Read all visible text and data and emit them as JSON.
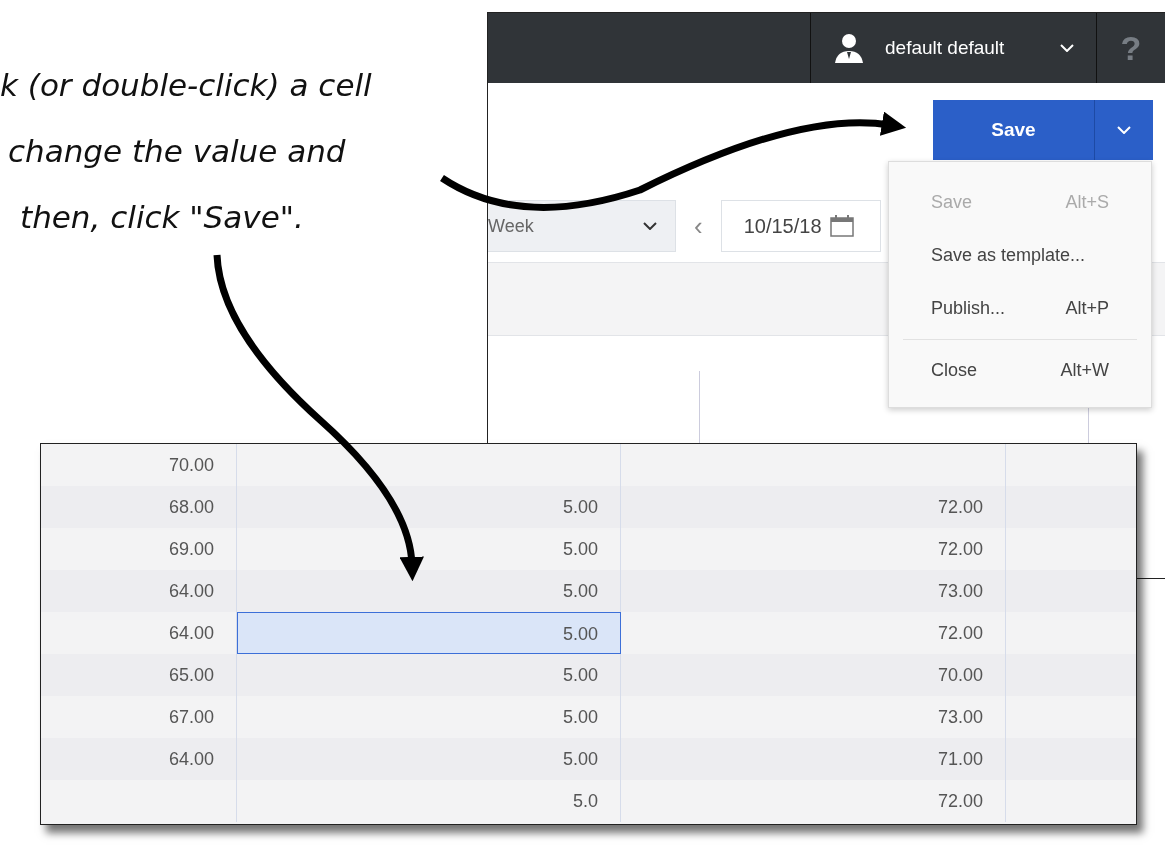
{
  "callout": {
    "lines": [
      "k (or double-click) a cell",
      "change the value and",
      "then, click \"Save\"."
    ]
  },
  "app": {
    "user": {
      "name": "default default"
    },
    "help": "?",
    "save_button": {
      "label": "Save"
    },
    "view_select": {
      "value": "Week"
    },
    "prev": "‹",
    "date_field": {
      "value": "10/15/18"
    },
    "save_menu": {
      "items": [
        {
          "label": "Save",
          "shortcut": "Alt+S",
          "disabled": true,
          "kind": "item"
        },
        {
          "label": "Save as template...",
          "disabled": false,
          "kind": "item"
        },
        {
          "label": "Publish...",
          "shortcut": "Alt+P",
          "disabled": false,
          "kind": "item"
        },
        {
          "kind": "separator"
        },
        {
          "label": "Close",
          "shortcut": "Alt+W",
          "disabled": false,
          "kind": "item"
        }
      ]
    }
  },
  "grid": {
    "rows": [
      {
        "cells": [
          {
            "value": "70.00",
            "selected": false
          },
          null,
          null
        ]
      },
      {
        "cells": [
          {
            "value": "68.00",
            "selected": false
          },
          {
            "value": "5.00",
            "selected": false
          },
          {
            "value": "72.00",
            "selected": false
          }
        ]
      },
      {
        "cells": [
          {
            "value": "69.00",
            "selected": false
          },
          {
            "value": "5.00",
            "selected": false
          },
          {
            "value": "72.00",
            "selected": false
          }
        ]
      },
      {
        "cells": [
          {
            "value": "64.00",
            "selected": false
          },
          {
            "value": "5.00",
            "selected": false
          },
          {
            "value": "73.00",
            "selected": false
          }
        ]
      },
      {
        "cells": [
          {
            "value": "64.00",
            "selected": false
          },
          {
            "value": "5.00",
            "selected": true
          },
          {
            "value": "72.00",
            "selected": false
          }
        ]
      },
      {
        "cells": [
          {
            "value": "65.00",
            "selected": false
          },
          {
            "value": "5.00",
            "selected": false
          },
          {
            "value": "70.00",
            "selected": false
          }
        ]
      },
      {
        "cells": [
          {
            "value": "67.00",
            "selected": false
          },
          {
            "value": "5.00",
            "selected": false
          },
          {
            "value": "73.00",
            "selected": false
          }
        ]
      },
      {
        "cells": [
          {
            "value": "64.00",
            "selected": false
          },
          {
            "value": "5.00",
            "selected": false
          },
          {
            "value": "71.00",
            "selected": false
          }
        ]
      },
      {
        "cells": [
          null,
          {
            "value": "5.0",
            "selected": false
          },
          {
            "value": "72.00",
            "selected": false
          }
        ]
      }
    ]
  }
}
